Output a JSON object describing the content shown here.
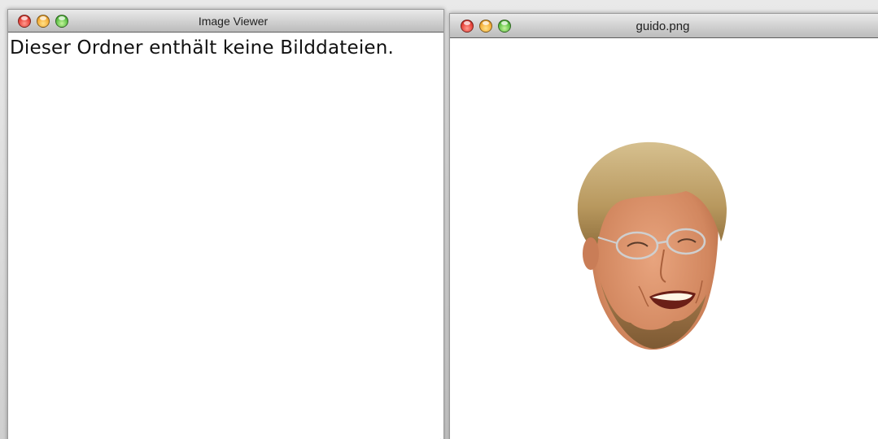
{
  "windows": {
    "viewer": {
      "title": "Image Viewer",
      "message": "Dieser Ordner enthält keine Bilddateien."
    },
    "image": {
      "title": "guido.png"
    }
  },
  "icons": {
    "traffic_lights": [
      "close-icon",
      "minimize-icon",
      "zoom-icon"
    ],
    "resize": "resize-grip-icon"
  },
  "colors": {
    "close": "#e8453c",
    "minimize": "#f5b03b",
    "zoom": "#62c34a"
  }
}
